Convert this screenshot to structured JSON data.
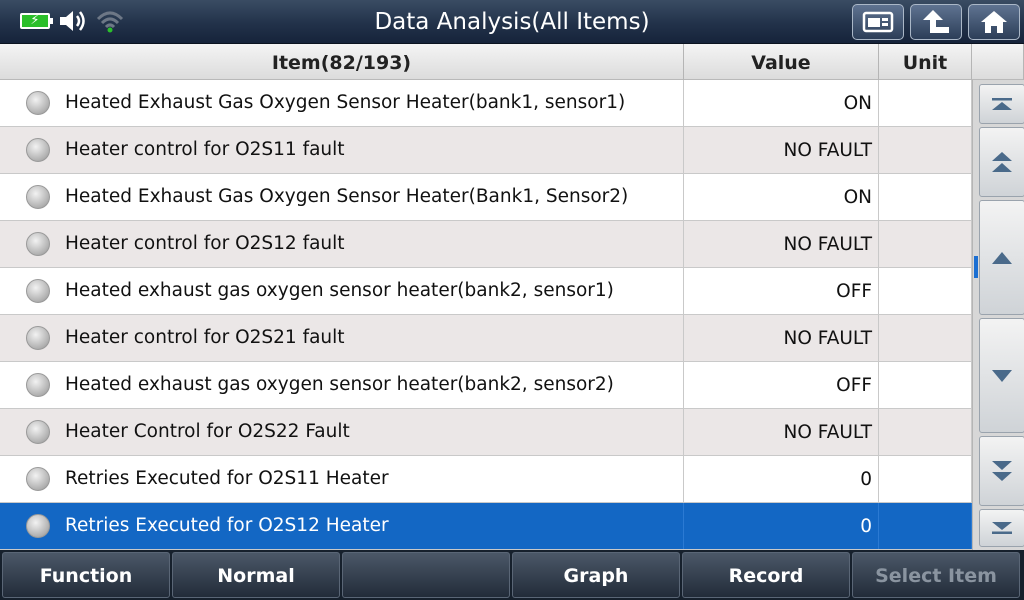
{
  "window": {
    "title": "Data Analysis(All Items)"
  },
  "status": {
    "battery_icon": "battery-charging-icon",
    "volume_icon": "speaker-icon",
    "wifi_icon": "wifi-icon",
    "battery_color": "#2bbf2b"
  },
  "title_buttons": [
    {
      "icon": "report-icon"
    },
    {
      "icon": "back-arrow-icon"
    },
    {
      "icon": "home-icon"
    }
  ],
  "table": {
    "headers": {
      "item": "Item(82/193)",
      "value": "Value",
      "unit": "Unit"
    },
    "rows": [
      {
        "item": "Heated Exhaust Gas Oxygen Sensor Heater(bank1, sensor1)",
        "value": "ON",
        "unit": ""
      },
      {
        "item": "Heater control for O2S11 fault",
        "value": "NO FAULT",
        "unit": ""
      },
      {
        "item": "Heated Exhaust Gas Oxygen Sensor Heater(Bank1, Sensor2)",
        "value": "ON",
        "unit": ""
      },
      {
        "item": "Heater control for O2S12 fault",
        "value": "NO FAULT",
        "unit": ""
      },
      {
        "item": "Heated exhaust gas oxygen sensor heater(bank2, sensor1)",
        "value": "OFF",
        "unit": ""
      },
      {
        "item": "Heater control for O2S21 fault",
        "value": "NO FAULT",
        "unit": ""
      },
      {
        "item": "Heated exhaust gas oxygen sensor heater(bank2, sensor2)",
        "value": "OFF",
        "unit": ""
      },
      {
        "item": "Heater Control for O2S22 Fault",
        "value": "NO FAULT",
        "unit": ""
      },
      {
        "item": "Retries Executed for O2S11 Heater",
        "value": "0",
        "unit": ""
      },
      {
        "item": "Retries Executed for O2S12 Heater",
        "value": "0",
        "unit": ""
      }
    ],
    "selected_row": 9,
    "selected_color": "#1367c4"
  },
  "scrollbar": {
    "buttons": [
      "scroll-top-icon",
      "page-up-icon",
      "line-up-icon",
      "line-down-icon",
      "page-down-icon",
      "scroll-bottom-icon"
    ]
  },
  "bottom_bar": {
    "buttons": [
      {
        "label": "Function",
        "enabled": true
      },
      {
        "label": "Normal",
        "enabled": true
      },
      {
        "label": "",
        "enabled": true
      },
      {
        "label": "Graph",
        "enabled": true
      },
      {
        "label": "Record",
        "enabled": true
      },
      {
        "label": "Select Item",
        "enabled": false
      }
    ]
  }
}
